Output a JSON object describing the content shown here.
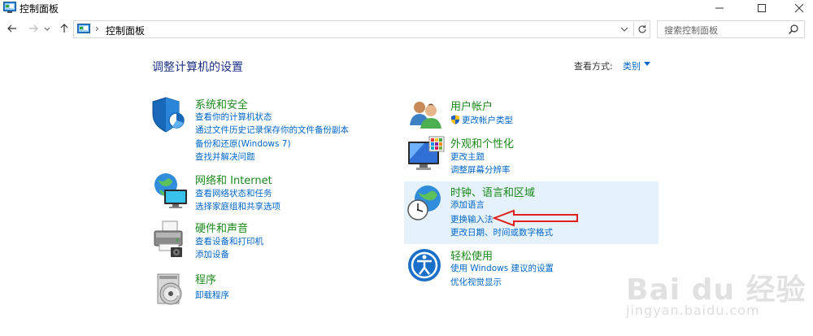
{
  "window": {
    "title": "控制面板",
    "minimize_glyph": "—",
    "maximize_glyph": "☐",
    "close_glyph": "✕"
  },
  "nav": {
    "breadcrumb_separator": "›",
    "breadcrumb": "控制面板",
    "search_placeholder": "搜索控制面板"
  },
  "header": {
    "heading": "调整计算机的设置",
    "view_by_label": "查看方式:",
    "view_by_value": "类别"
  },
  "categories": [
    {
      "title": "系统和安全",
      "icon": "shield-icon",
      "links": [
        "查看你的计算机状态",
        "通过文件历史记录保存你的文件备份副本",
        "备份和还原(Windows 7)",
        "查找并解决问题"
      ]
    },
    {
      "title": "网络和 Internet",
      "icon": "network-globe-icon",
      "links": [
        "查看网络状态和任务",
        "选择家庭组和共享选项"
      ]
    },
    {
      "title": "硬件和声音",
      "icon": "printer-icon",
      "links": [
        "查看设备和打印机",
        "添加设备"
      ]
    },
    {
      "title": "程序",
      "icon": "programs-disc-icon",
      "links": [
        "卸载程序"
      ]
    },
    {
      "title": "用户帐户",
      "icon": "users-icon",
      "links": [
        "更改帐户类型"
      ]
    },
    {
      "title": "外观和个性化",
      "icon": "monitor-icon",
      "links": [
        "更改主题",
        "调整屏幕分辨率"
      ]
    },
    {
      "title": "时钟、语言和区域",
      "icon": "clock-globe-icon",
      "links": [
        "添加语言",
        "更换输入法",
        "更改日期、时间或数字格式"
      ]
    },
    {
      "title": "轻松使用",
      "icon": "ease-of-access-icon",
      "links": [
        "使用 Windows 建议的设置",
        "优化视觉显示"
      ]
    }
  ],
  "watermark": {
    "line1": "Bai du 经验",
    "line2": "jingyan.baidu.com"
  },
  "colors": {
    "category_title": "#1a8a1a",
    "link": "#0066cc",
    "heading": "#1e3287",
    "highlight": "#e5f1fb",
    "annotation_arrow": "#e02020"
  }
}
